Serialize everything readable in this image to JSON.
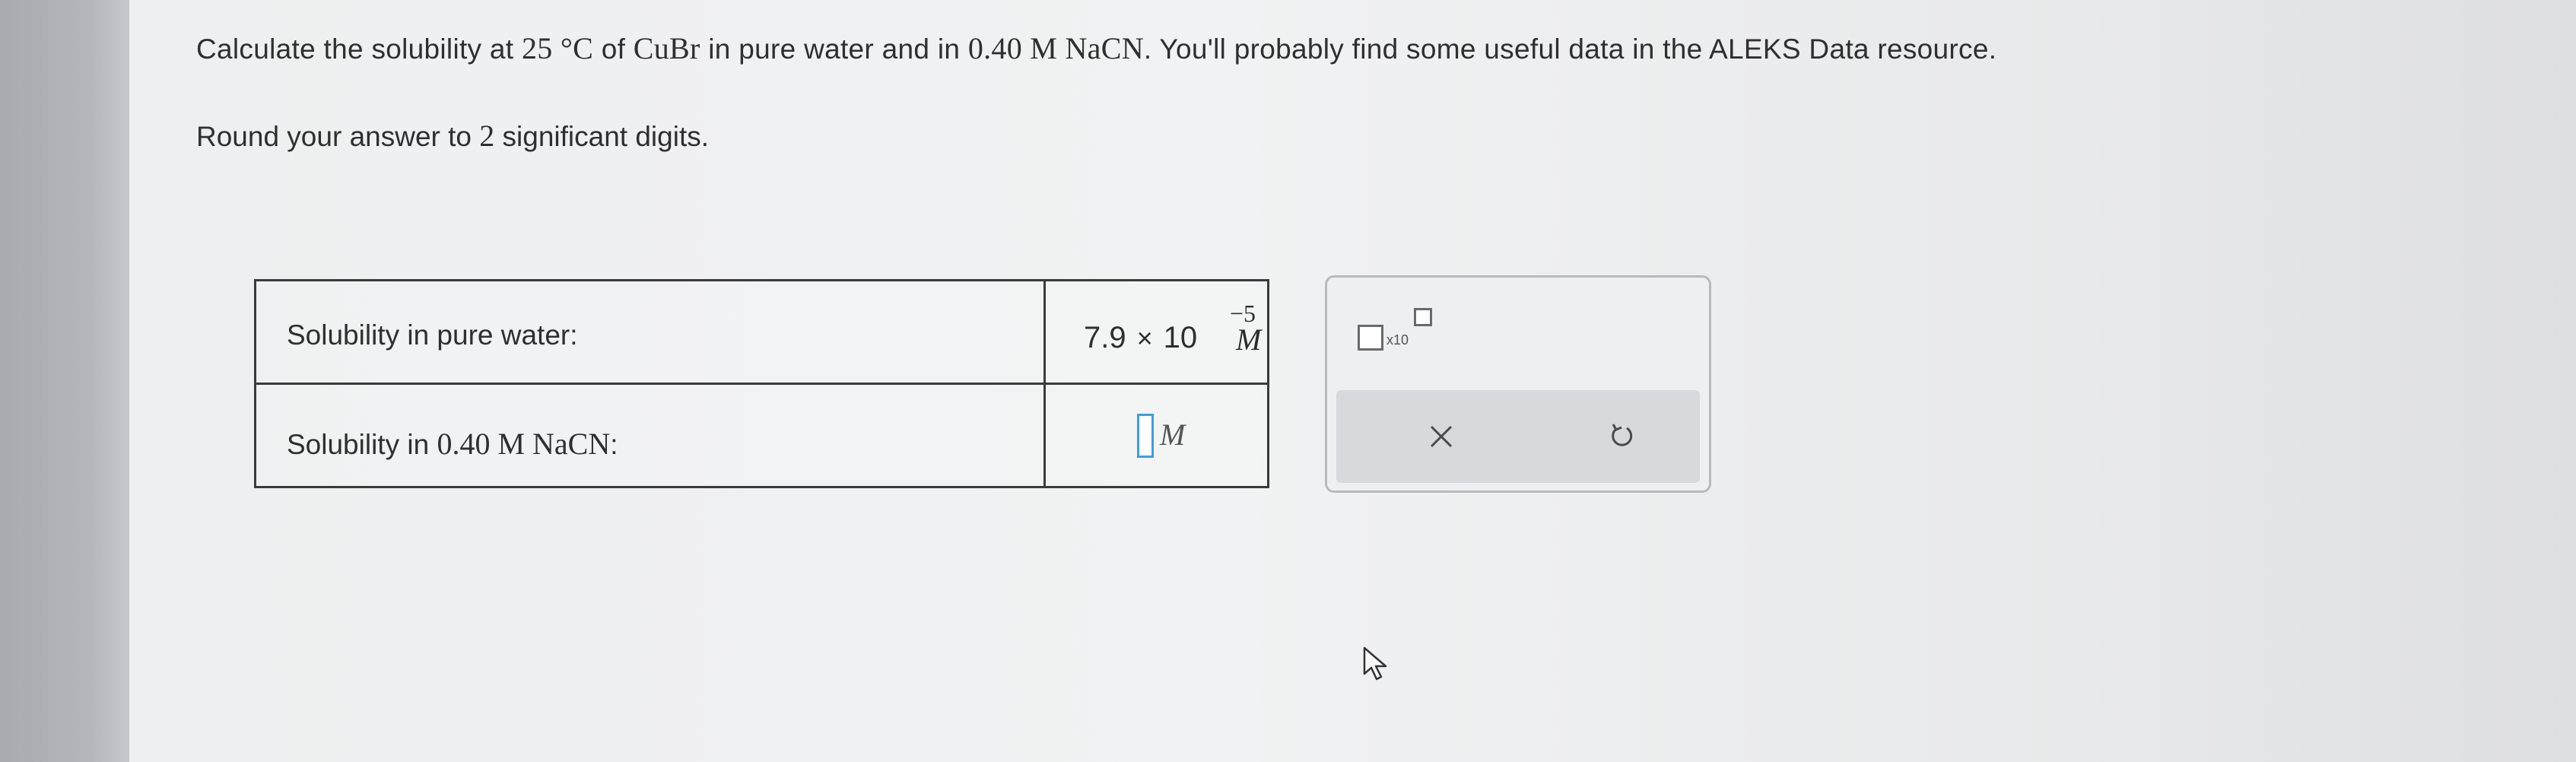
{
  "question": {
    "intro": "Calculate the solubility at ",
    "temperature": "25 °C",
    "of_text": " of ",
    "compound": "CuBr",
    "middle": " in pure water and in ",
    "concentration": "0.40 M NaCN",
    "ending": ". You'll probably find some useful data in the ALEKS Data resource.",
    "rounding_prefix": "Round your answer to ",
    "rounding_digits": "2",
    "rounding_suffix": " significant digits."
  },
  "table": {
    "rows": [
      {
        "label": "Solubility in pure water:",
        "value_mantissa": "7.9",
        "value_times": "×",
        "value_base": "10",
        "value_exponent": "−5",
        "unit": "M"
      },
      {
        "label_prefix": "Solubility in ",
        "label_math": "0.40 M NaCN",
        "label_suffix": ":",
        "input_value": "",
        "unit": "M"
      }
    ]
  },
  "toolbar": {
    "sci_notation_label": "x10",
    "clear_icon": "close-icon",
    "undo_icon": "undo-icon"
  },
  "colors": {
    "input_focus": "#3b9ee0",
    "border": "#3a3a3a"
  }
}
